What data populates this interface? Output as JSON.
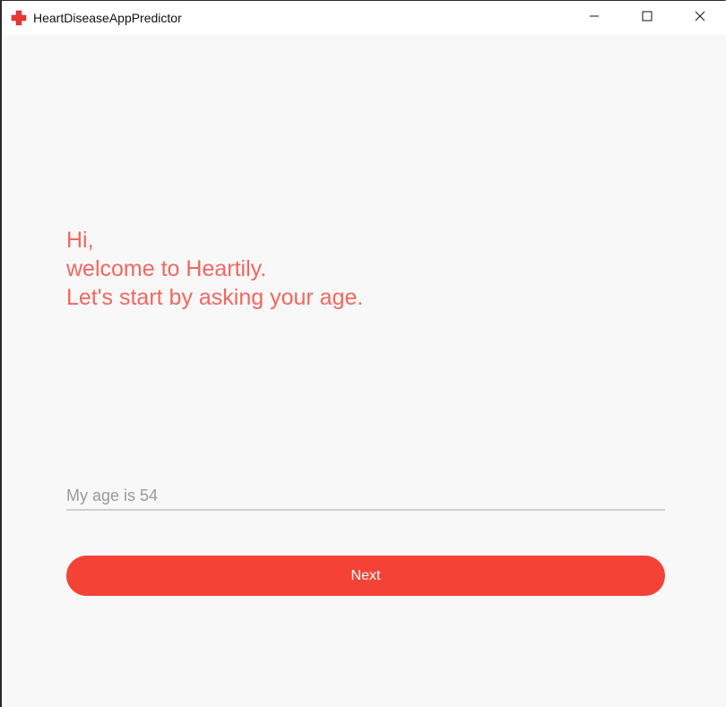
{
  "window": {
    "title": "HeartDiseaseAppPredictor",
    "icon": "red-cross-icon",
    "accent_color": "#f44336",
    "controls": {
      "minimize": "minimize-icon",
      "maximize": "maximize-icon",
      "close": "close-icon"
    }
  },
  "main": {
    "greeting": {
      "line1": "Hi,",
      "line2": "welcome to Heartily.",
      "line3": "Let's start by asking your age."
    },
    "age_input": {
      "value": "My age is 54"
    },
    "next_label": "Next"
  }
}
